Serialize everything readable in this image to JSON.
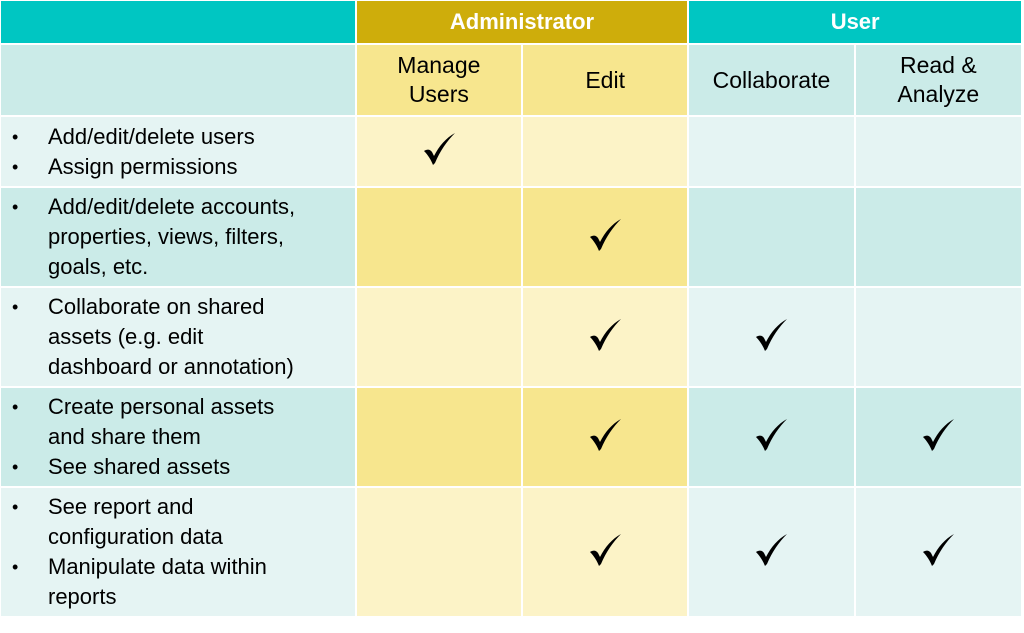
{
  "groups": [
    {
      "label": "",
      "span": 1,
      "color": "#00c6c2"
    },
    {
      "label": "Administrator",
      "span": 2,
      "color": "#cead0b"
    },
    {
      "label": "User",
      "span": 2,
      "color": "#00c6c2"
    }
  ],
  "columns": [
    {
      "label": "",
      "group": "description"
    },
    {
      "label": "Manage Users",
      "line1": "Manage",
      "line2": "Users",
      "group": "Administrator"
    },
    {
      "label": "Edit",
      "line1": "Edit",
      "line2": "",
      "group": "Administrator"
    },
    {
      "label": "Collaborate",
      "line1": "Collaborate",
      "line2": "",
      "group": "User"
    },
    {
      "label": "Read & Analyze",
      "line1": "Read &",
      "line2": "Analyze",
      "group": "User"
    }
  ],
  "rows": [
    {
      "bullets": [
        {
          "lines": [
            "Add/edit/delete users"
          ]
        },
        {
          "lines": [
            "Assign permissions"
          ]
        }
      ],
      "checks": {
        "manage_users": true,
        "edit": false,
        "collaborate": false,
        "read_analyze": false
      }
    },
    {
      "bullets": [
        {
          "lines": [
            "Add/edit/delete accounts,",
            "properties, views, filters,",
            "goals, etc."
          ]
        }
      ],
      "checks": {
        "manage_users": false,
        "edit": true,
        "collaborate": false,
        "read_analyze": false
      }
    },
    {
      "bullets": [
        {
          "lines": [
            "Collaborate on shared",
            "assets (e.g. edit",
            "dashboard or annotation)"
          ]
        }
      ],
      "checks": {
        "manage_users": false,
        "edit": true,
        "collaborate": true,
        "read_analyze": false
      }
    },
    {
      "bullets": [
        {
          "lines": [
            "Create personal assets",
            "and share them"
          ]
        },
        {
          "lines": [
            "See shared assets"
          ]
        }
      ],
      "checks": {
        "manage_users": false,
        "edit": true,
        "collaborate": true,
        "read_analyze": true
      }
    },
    {
      "bullets": [
        {
          "lines": [
            "See report and",
            "configuration data"
          ]
        },
        {
          "lines": [
            "Manipulate data within",
            "reports"
          ]
        }
      ],
      "checks": {
        "manage_users": false,
        "edit": true,
        "collaborate": true,
        "read_analyze": true
      }
    }
  ],
  "icons": {
    "check": "checkmark-icon"
  },
  "colors": {
    "teal_header": "#00c6c2",
    "gold_header": "#cead0b",
    "teal_dark": "#cbebe8",
    "teal_light": "#e5f4f3",
    "gold_dark": "#f7e68e",
    "gold_light": "#fcf3c7"
  }
}
